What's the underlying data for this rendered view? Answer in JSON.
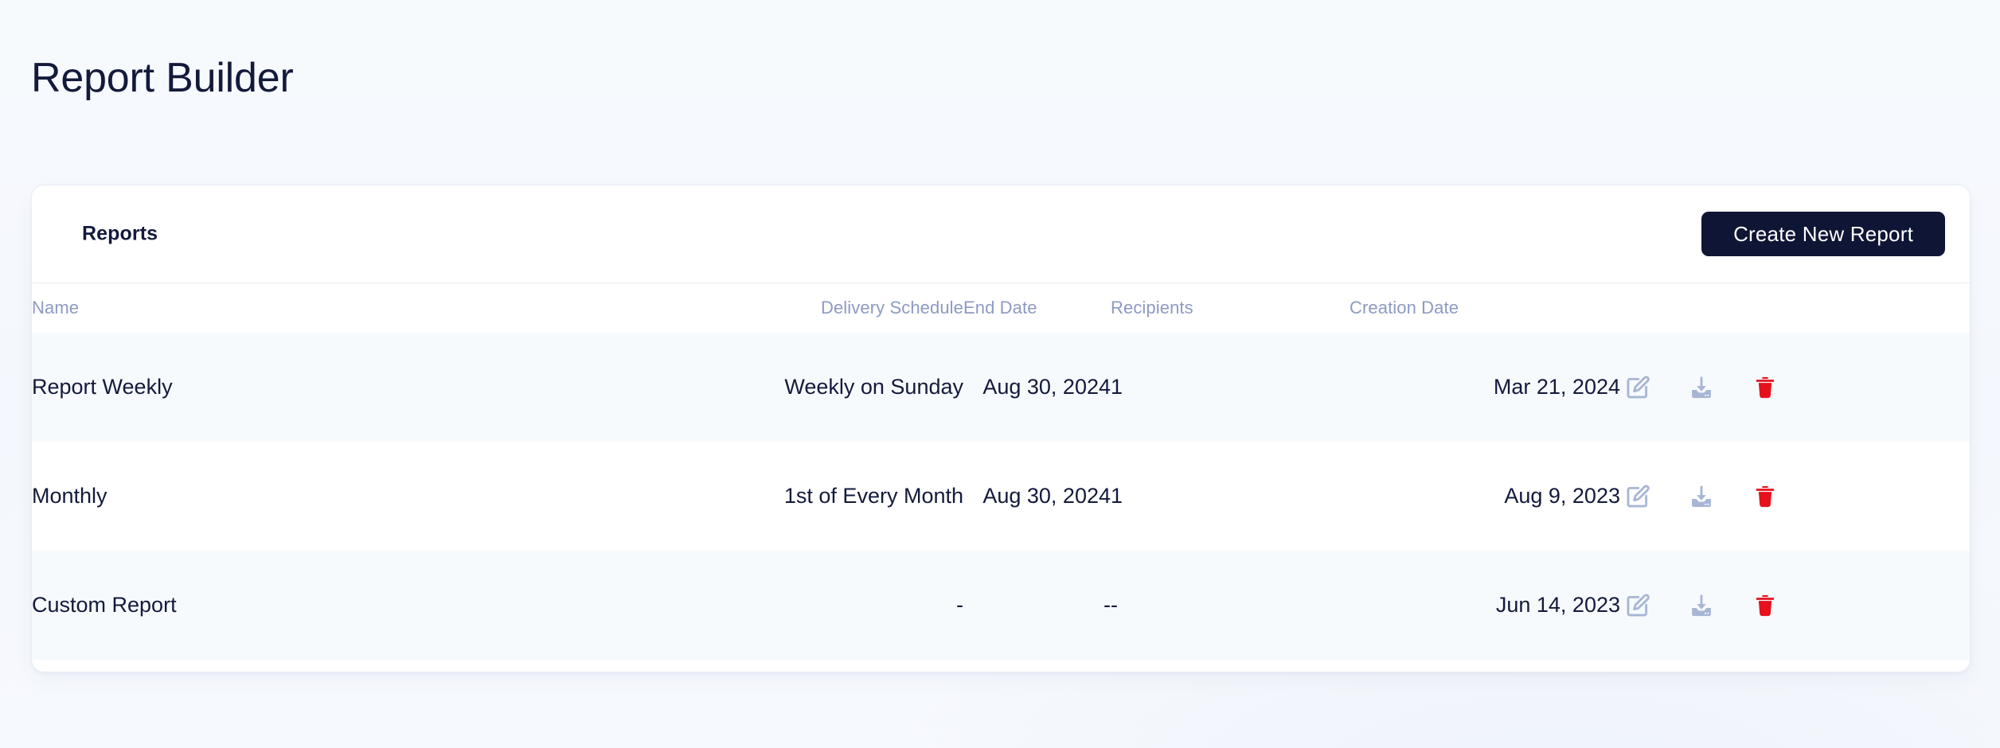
{
  "page": {
    "title": "Report Builder",
    "background_color": "#f5f8fd"
  },
  "card": {
    "header": {
      "title": "Reports",
      "create_button_label": "Create New Report",
      "create_button_color": "#0f1535"
    },
    "table": {
      "columns": [
        {
          "key": "name",
          "label": "Name"
        },
        {
          "key": "delivery",
          "label": "Delivery Schedule"
        },
        {
          "key": "end_date",
          "label": "End Date"
        },
        {
          "key": "recipients",
          "label": "Recipients"
        },
        {
          "key": "creation_date",
          "label": "Creation Date"
        },
        {
          "key": "actions",
          "label": ""
        }
      ],
      "rows": [
        {
          "name": "Report Weekly",
          "delivery": "Weekly on Sunday",
          "end_date": "Aug 30, 2024",
          "recipients": "1",
          "creation_date": "Mar 21, 2024",
          "actions": [
            "edit-icon",
            "download-icon",
            "delete-icon"
          ]
        },
        {
          "name": "Monthly",
          "delivery": "1st of Every Month",
          "end_date": "Aug 30, 2024",
          "recipients": "1",
          "creation_date": "Aug 9, 2023",
          "actions": [
            "edit-icon",
            "download-icon",
            "delete-icon"
          ]
        },
        {
          "name": "Custom Report",
          "delivery": "-",
          "end_date": "-",
          "recipients": "-",
          "creation_date": "Jun 14, 2023",
          "actions": [
            "edit-icon",
            "download-icon",
            "delete-icon"
          ]
        }
      ]
    }
  },
  "colors": {
    "text_primary": "#131a3b",
    "text_muted": "#8d9ac2",
    "row_alt": "#f7fafd",
    "icon_slate": "#a8b6d4",
    "icon_danger": "#e6111c"
  }
}
